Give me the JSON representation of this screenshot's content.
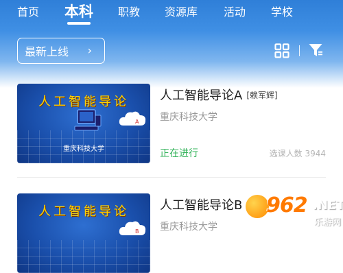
{
  "nav": {
    "tabs": [
      {
        "label": "首页"
      },
      {
        "label": "本科"
      },
      {
        "label": "职教"
      },
      {
        "label": "资源库"
      },
      {
        "label": "活动"
      },
      {
        "label": "学校"
      }
    ],
    "active_tab": "本科"
  },
  "toolbar": {
    "sort_label": "最新上线",
    "sort_chevron": "›",
    "grid_icon": "grid-view-icon",
    "filter_icon": "filter-icon"
  },
  "courses": [
    {
      "thumb_title": "人工智能导论",
      "thumb_school": "重庆科技大学",
      "thumb_badge": "A",
      "title": "人工智能导论A",
      "teacher_tag": "[赖军辉]",
      "school": "重庆科技大学",
      "status": "正在进行",
      "enroll": "选课人数 3944"
    },
    {
      "thumb_title": "人工智能导论",
      "thumb_badge": "B",
      "title": "人工智能导论B",
      "school": "重庆科技大学"
    }
  ],
  "watermark": {
    "logo": "962",
    "net": ".NET",
    "sub": "乐游网"
  },
  "colors": {
    "header_top": "#2f7fd8",
    "status_green": "#33b35a",
    "thumb_title": "#ffd200"
  }
}
